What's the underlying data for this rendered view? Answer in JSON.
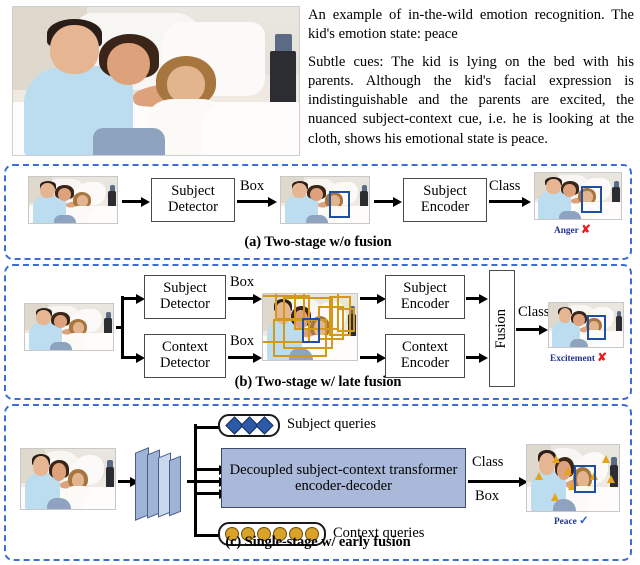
{
  "figure": {
    "caption_paragraphs": [
      "An example of in-the-wild emotion recognition. The kid's emotion state: peace",
      "Subtle cues: The kid is lying on the bed with his parents. Although the kid's facial expression is indistinguishable and the parents are excited, the nuanced subject-context cue, i.e. he is looking at the cloth, shows his emotional state is peace."
    ],
    "caption_line_1": "An example of in-the-wild emotion recognition.",
    "caption_line_2": "The kid's emotion state: peace",
    "caption_body": "Subtle cues: The kid is lying on the bed with his parents. Although the kid's facial expression is indistinguishable and the parents are excited, the nuanced subject-context cue, i.e. he is looking at the cloth, shows his emotional state is peace."
  },
  "panel_a": {
    "caption": "(a) Two-stage w/o fusion",
    "blocks": [
      {
        "line1": "Subject",
        "line2": "Detector"
      },
      {
        "line1": "Subject",
        "line2": "Encoder"
      }
    ],
    "edge_labels": [
      "Box",
      "Class"
    ],
    "prediction": {
      "label": "Anger",
      "mark": "✘",
      "correct": false
    }
  },
  "panel_b": {
    "caption": "(b) Two-stage w/ late fusion",
    "detectors": [
      {
        "line1": "Subject",
        "line2": "Detector"
      },
      {
        "line1": "Context",
        "line2": "Detector"
      }
    ],
    "encoders": [
      {
        "line1": "Subject",
        "line2": "Encoder"
      },
      {
        "line1": "Context",
        "line2": "Encoder"
      }
    ],
    "fusion_label": "Fusion",
    "edge_labels": [
      "Box",
      "Box",
      "Class"
    ],
    "prediction": {
      "label": "Excitement",
      "mark": "✘",
      "correct": false
    }
  },
  "panel_c": {
    "caption": "(c) Single-stage w/ early fusion",
    "transformer": {
      "line1": "Decoupled subject-context transformer",
      "line2": "encoder-decoder"
    },
    "subject_queries": {
      "label": "Subject queries",
      "count": 3,
      "shape": "diamond",
      "color": "#2d5aa8"
    },
    "context_queries": {
      "label": "Context queries",
      "count": 6,
      "shape": "circle",
      "color": "#d9a22b"
    },
    "edge_labels": [
      "Class",
      "Box"
    ],
    "prediction": {
      "label": "Peace",
      "mark": "✓",
      "correct": true
    }
  },
  "colors": {
    "panel_border": "#3b6fd4",
    "subject_box": "#1f4fa3",
    "context_box": "#d39a18",
    "transformer_fill": "#aab9d9",
    "cnn_fill": "#9db4d6",
    "wrong_mark": "#e81c1c",
    "right_mark": "#2f5fc4",
    "prediction_text": "#24348c"
  }
}
